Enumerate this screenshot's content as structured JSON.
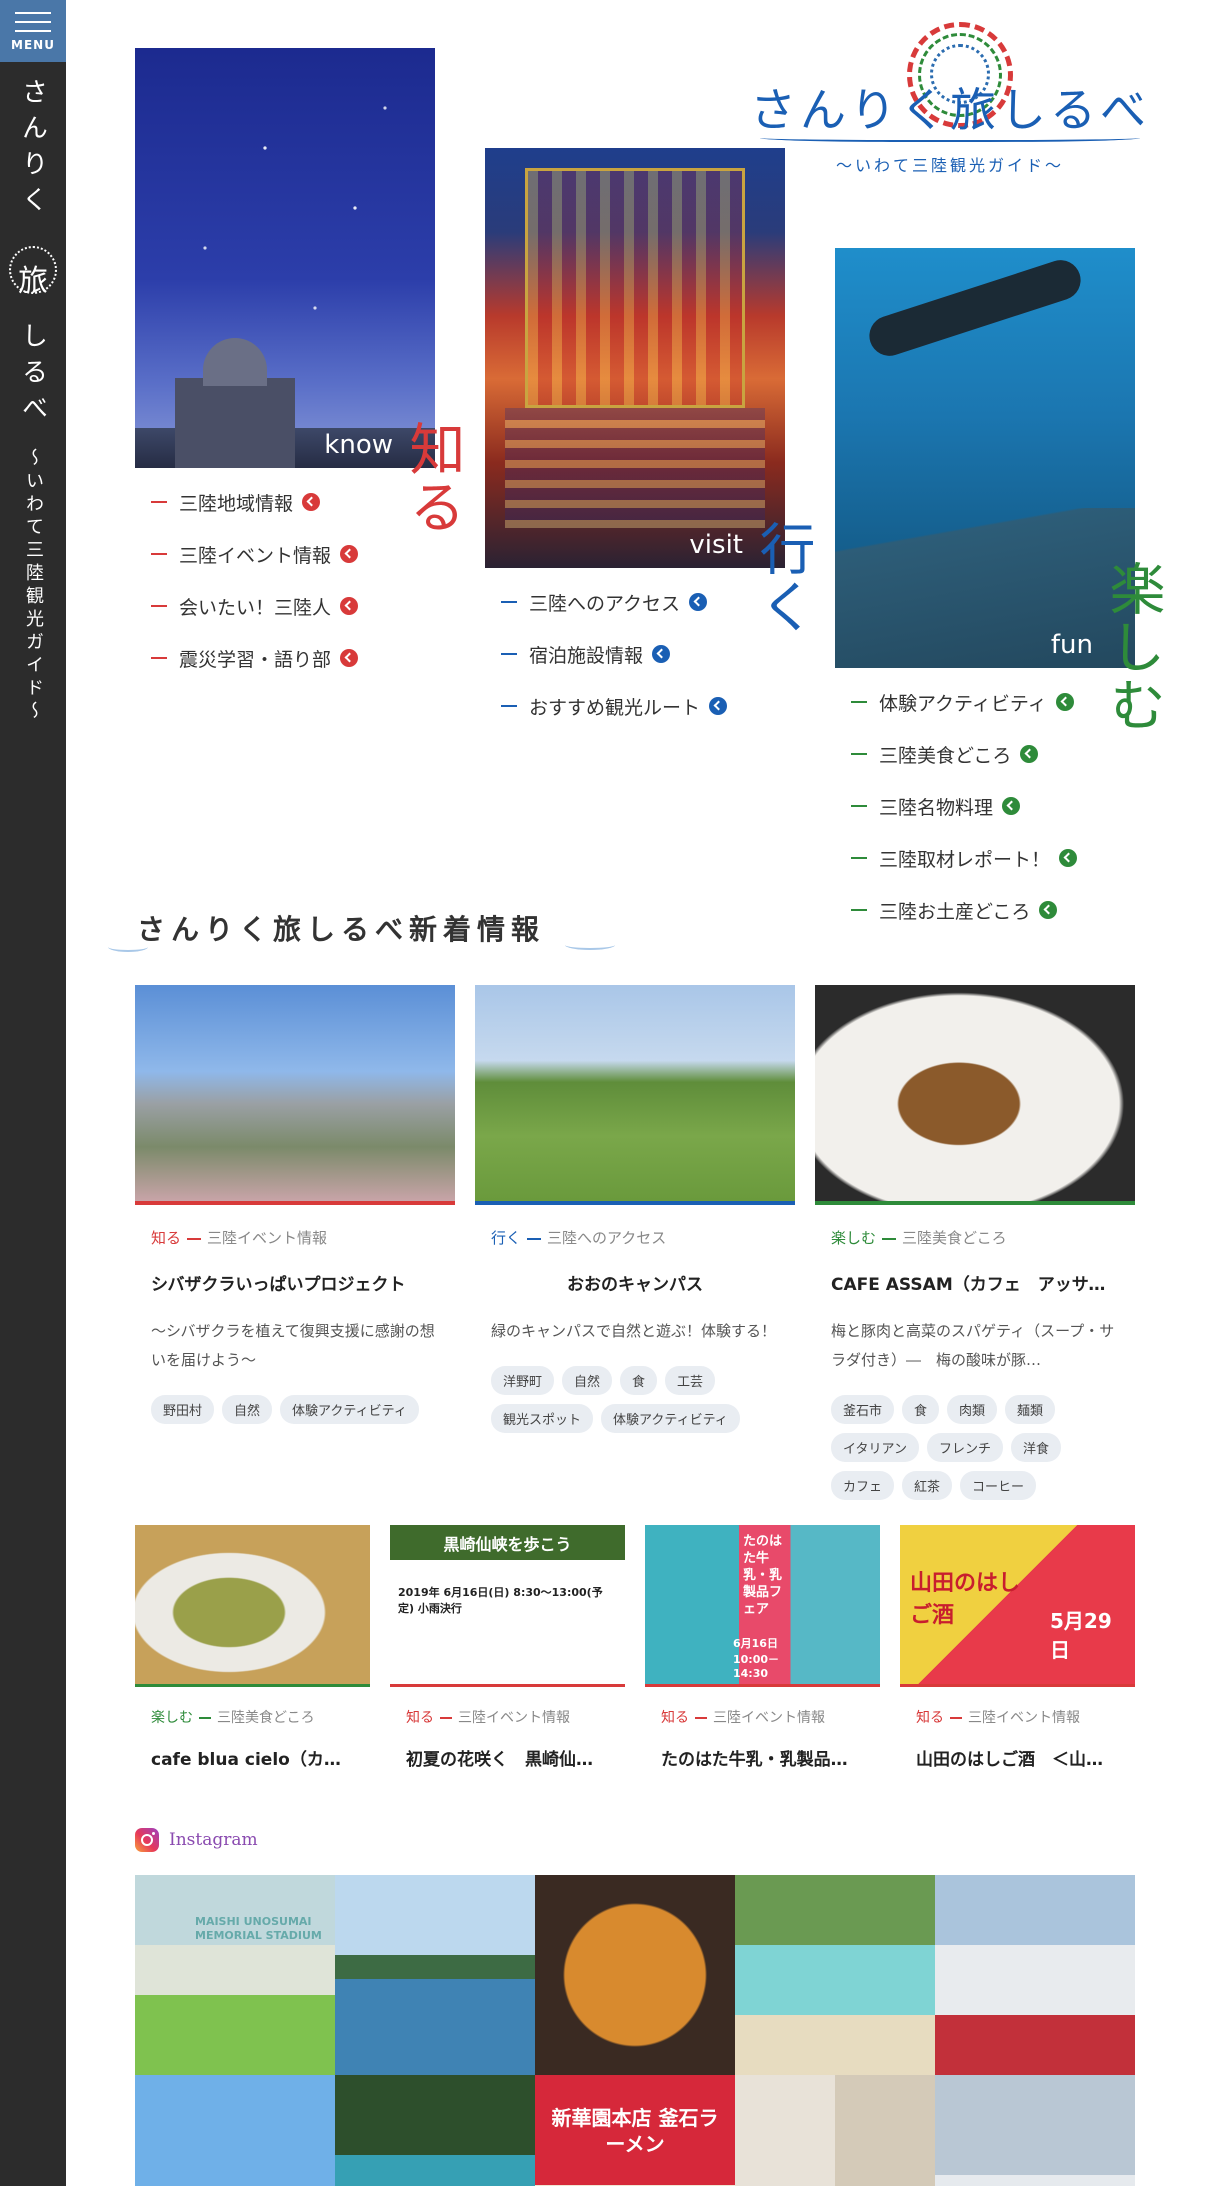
{
  "sidebar": {
    "menu_label": "MENU",
    "title_top": "さんりく",
    "logo_char": "旅",
    "title_bottom": "しるべ",
    "subtitle": "〜いわて三陸観光ガイド〜"
  },
  "logo": {
    "title": "さんりく旅しるべ",
    "subtitle": "〜いわて三陸観光ガイド〜"
  },
  "categories": [
    {
      "en": "know",
      "jp": "知る",
      "color": "#d83a3a",
      "links": [
        "三陸地域情報",
        "三陸イベント情報",
        "会いたい！三陸人",
        "震災学習・語り部"
      ]
    },
    {
      "en": "visit",
      "jp": "行く",
      "color": "#1a5fb4",
      "links": [
        "三陸へのアクセス",
        "宿泊施設情報",
        "おすすめ観光ルート"
      ]
    },
    {
      "en": "fun",
      "jp": "楽しむ",
      "color": "#2e8b3a",
      "links": [
        "体験アクティビティ",
        "三陸美食どころ",
        "三陸名物料理",
        "三陸取材レポート！",
        "三陸お土産どころ"
      ]
    }
  ],
  "news": {
    "title": "さんりく旅しるべ新着情報",
    "featured": [
      {
        "cat1": "知る",
        "cat2": "三陸イベント情報",
        "title": "シバザクラいっぱいプロジェクト",
        "desc": "〜シバザクラを植えて復興支援に感謝の想いを届けよう〜",
        "tags": [
          "野田村",
          "自然",
          "体験アクティビティ"
        ]
      },
      {
        "cat1": "行く",
        "cat2": "三陸へのアクセス",
        "title": "おおのキャンパス",
        "desc": "緑のキャンパスで自然と遊ぶ！体験する！",
        "tags": [
          "洋野町",
          "自然",
          "食",
          "工芸",
          "観光スポット",
          "体験アクティビティ"
        ]
      },
      {
        "cat1": "楽しむ",
        "cat2": "三陸美食どころ",
        "title": "CAFE ASSAM（カフェ　アッサム）",
        "desc": "梅と豚肉と高菜のスパゲティ（スープ・サラダ付き）―　梅の酸味が豚…",
        "tags": [
          "釜石市",
          "食",
          "肉類",
          "麺類",
          "イタリアン",
          "フレンチ",
          "洋食",
          "カフェ",
          "紅茶",
          "コーヒー"
        ]
      }
    ],
    "more": [
      {
        "cat1": "楽しむ",
        "cat2": "三陸美食どころ",
        "title": "cafe blua cielo（カフェ ブルア チェーロ）"
      },
      {
        "cat1": "知る",
        "cat2": "三陸イベント情報",
        "title": "初夏の花咲く　黒崎仙峡を歩こう",
        "poster_heading": "黒崎仙峡を歩こう",
        "poster_date": "2019年 6月16日(日) 8:30～13:00(予定) 小雨決行"
      },
      {
        "cat1": "知る",
        "cat2": "三陸イベント情報",
        "title": "たのはた牛乳・乳製品フェア",
        "poster_heading": "たのはた牛乳・乳製品フェア",
        "poster_date": "6月16日 10:00－14:30"
      },
      {
        "cat1": "知る",
        "cat2": "三陸イベント情報",
        "title": "山田のはしご酒　＜山田町＞",
        "poster_heading": "山田のはしご酒",
        "poster_date": "5月29日"
      }
    ]
  },
  "instagram": {
    "label": "Instagram",
    "photos": [
      "ig-photo-1",
      "ig-photo-2",
      "ig-photo-3",
      "ig-photo-4",
      "ig-photo-5",
      "ig-photo-6",
      "ig-photo-7",
      "ig-photo-8",
      "ig-photo-9",
      "ig-photo-10"
    ],
    "photo1_caption": "MAISHI UNOSUMAI MEMORIAL STADIUM",
    "photo8_caption": "新華園本店 釜石ラーメン"
  }
}
